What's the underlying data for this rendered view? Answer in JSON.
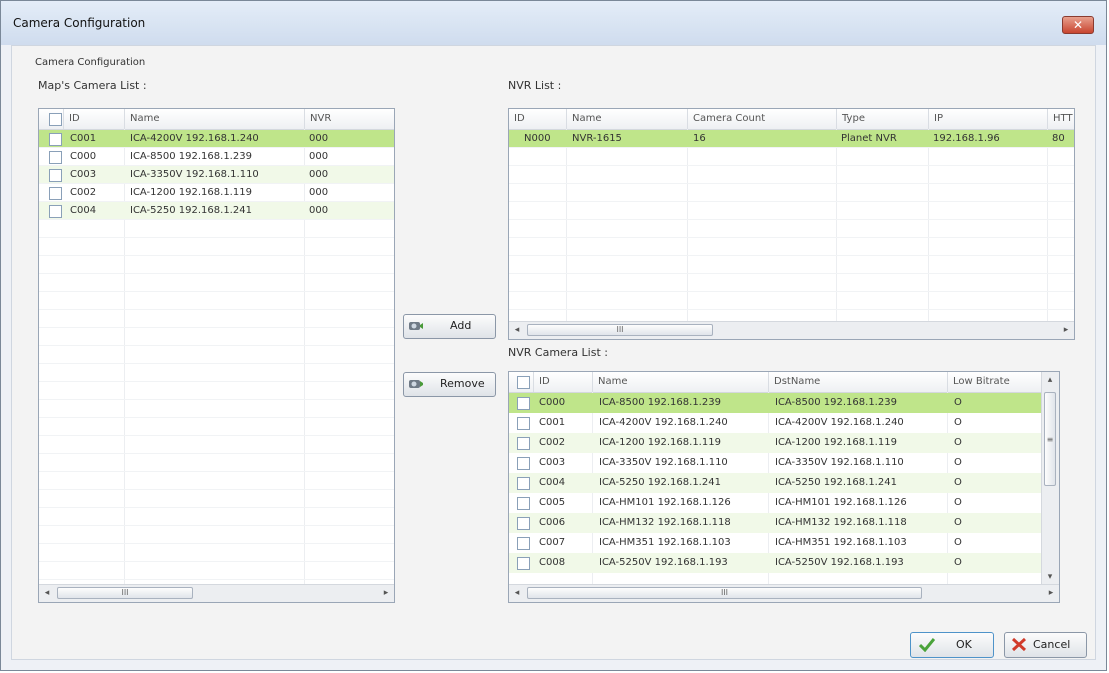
{
  "window": {
    "title": "Camera Configuration",
    "close_icon": "close-x-icon"
  },
  "group_title": "Camera Configuration",
  "maps_camera_list": {
    "label": "Map's Camera List :",
    "columns": [
      "ID",
      "Name",
      "NVR"
    ],
    "rows": [
      {
        "id": "C001",
        "name": "ICA-4200V 192.168.1.240",
        "nvr": "000"
      },
      {
        "id": "C000",
        "name": "ICA-8500 192.168.1.239",
        "nvr": "000"
      },
      {
        "id": "C003",
        "name": "ICA-3350V 192.168.1.110",
        "nvr": "000"
      },
      {
        "id": "C002",
        "name": "ICA-1200 192.168.1.119",
        "nvr": "000"
      },
      {
        "id": "C004",
        "name": "ICA-5250 192.168.1.241",
        "nvr": "000"
      }
    ],
    "scroll_left": "◂",
    "scroll_right": "▸",
    "thumb_grip": "III"
  },
  "nvr_list": {
    "label": "NVR List :",
    "columns": [
      "ID",
      "Name",
      "Camera Count",
      "Type",
      "IP",
      "HTT"
    ],
    "rows": [
      {
        "id": "N000",
        "name": "NVR-1615",
        "count": "16",
        "type": "Planet NVR",
        "ip": "192.168.1.96",
        "http": "80"
      }
    ],
    "scroll_left": "◂",
    "scroll_right": "▸",
    "thumb_grip": "III"
  },
  "nvr_camera_list": {
    "label": "NVR Camera List :",
    "columns": [
      "ID",
      "Name",
      "DstName",
      "Low Bitrate"
    ],
    "rows": [
      {
        "id": "C000",
        "name": "ICA-8500 192.168.1.239",
        "dst": "ICA-8500 192.168.1.239",
        "low": "O"
      },
      {
        "id": "C001",
        "name": "ICA-4200V 192.168.1.240",
        "dst": "ICA-4200V 192.168.1.240",
        "low": "O"
      },
      {
        "id": "C002",
        "name": "ICA-1200 192.168.1.119",
        "dst": "ICA-1200 192.168.1.119",
        "low": "O"
      },
      {
        "id": "C003",
        "name": "ICA-3350V 192.168.1.110",
        "dst": "ICA-3350V 192.168.1.110",
        "low": "O"
      },
      {
        "id": "C004",
        "name": "ICA-5250 192.168.1.241",
        "dst": "ICA-5250 192.168.1.241",
        "low": "O"
      },
      {
        "id": "C005",
        "name": "ICA-HM101 192.168.1.126",
        "dst": "ICA-HM101 192.168.1.126",
        "low": "O"
      },
      {
        "id": "C006",
        "name": "ICA-HM132 192.168.1.118",
        "dst": "ICA-HM132 192.168.1.118",
        "low": "O"
      },
      {
        "id": "C007",
        "name": "ICA-HM351 192.168.1.103",
        "dst": "ICA-HM351 192.168.1.103",
        "low": "O"
      },
      {
        "id": "C008",
        "name": "ICA-5250V 192.168.1.193",
        "dst": "ICA-5250V 192.168.1.193",
        "low": "O"
      }
    ],
    "scroll_left": "◂",
    "scroll_right": "▸",
    "scroll_up": "▴",
    "scroll_down": "▾",
    "thumb_grip": "III",
    "vthumb_grip": "≡"
  },
  "buttons": {
    "add": "Add",
    "remove": "Remove",
    "ok": "OK",
    "cancel": "Cancel"
  },
  "colors": {
    "selected_row": "#bfe58a",
    "alt_row": "#f1f9e8"
  }
}
